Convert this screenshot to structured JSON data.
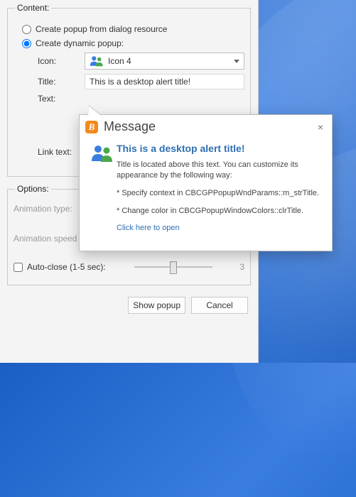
{
  "content": {
    "legend": "Content:",
    "radio1": "Create popup from dialog resource",
    "radio2": "Create dynamic popup:",
    "iconLabel": "Icon:",
    "iconValue": "Icon 4",
    "titleLabel": "Title:",
    "titleValue": "This is a desktop alert title!",
    "textLabel": "Text:",
    "linkLabel": "Link text:"
  },
  "options": {
    "legend": "Options:",
    "animTypeLabel": "Animation type:",
    "animSpeedLabel": "Animation speed (msec):",
    "autoCloseLabel": "Auto-close (1-5 sec):",
    "autoCloseValue": "3"
  },
  "buttons": {
    "show": "Show popup",
    "cancel": "Cancel"
  },
  "popup": {
    "heading": "Message",
    "title": "This is a desktop alert title!",
    "desc": "Title is located above this text. You can customize its appearance by the following way:",
    "line1": "* Specify context in CBCGPPopupWndParams::m_strTitle.",
    "line2": "* Change color in CBCGPopupWindowColors::clrTitle.",
    "link": "Click here to open",
    "close": "×"
  }
}
